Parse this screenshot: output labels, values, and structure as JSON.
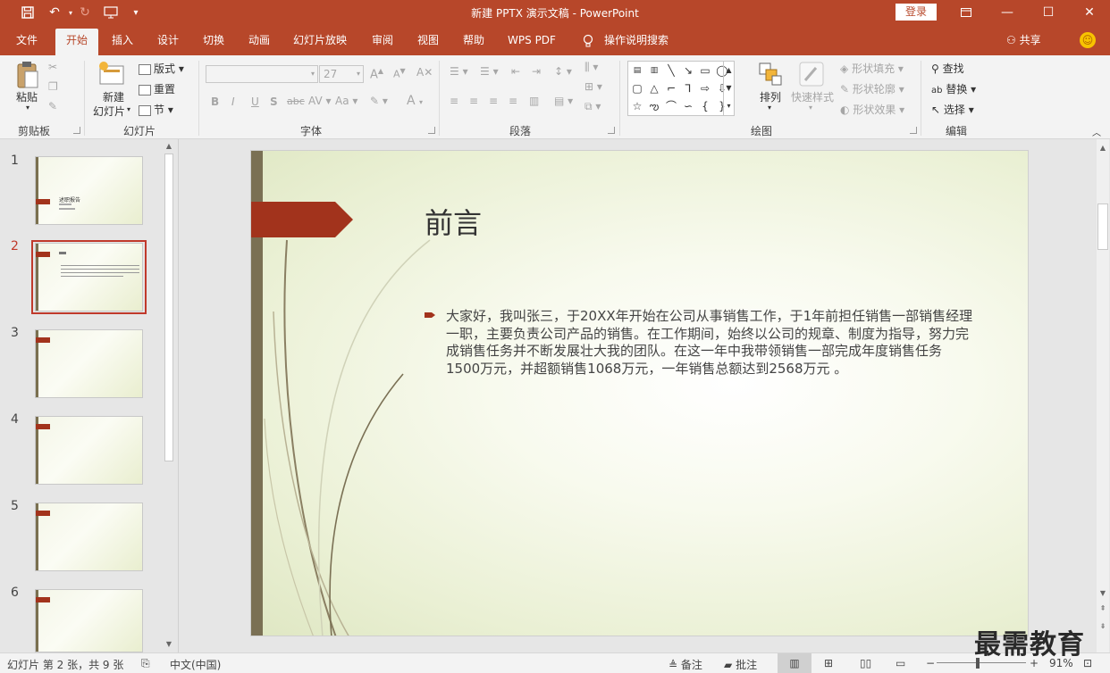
{
  "window": {
    "title": "新建 PPTX 演示文稿 - PowerPoint",
    "login_label": "登录"
  },
  "tabs": [
    {
      "label": "文件"
    },
    {
      "label": "开始"
    },
    {
      "label": "插入"
    },
    {
      "label": "设计"
    },
    {
      "label": "切换"
    },
    {
      "label": "动画"
    },
    {
      "label": "幻灯片放映"
    },
    {
      "label": "审阅"
    },
    {
      "label": "视图"
    },
    {
      "label": "帮助"
    },
    {
      "label": "WPS PDF"
    },
    {
      "label": "操作说明搜索"
    }
  ],
  "share_label": "共享",
  "ribbon": {
    "clipboard": {
      "paste": "粘贴",
      "group": "剪贴板"
    },
    "slides": {
      "new_slide_1": "新建",
      "new_slide_2": "幻灯片",
      "layout": "版式",
      "reset": "重置",
      "section": "节",
      "group": "幻灯片"
    },
    "font": {
      "size": "27",
      "group": "字体",
      "bold": "B",
      "italic": "I",
      "underline": "U",
      "strike": "abc",
      "aa": "Aa",
      "a": "A"
    },
    "paragraph": {
      "group": "段落"
    },
    "drawing": {
      "arrange": "排列",
      "quick_styles": "快速样式",
      "shape_fill": "形状填充",
      "shape_outline": "形状轮廓",
      "shape_effects": "形状效果",
      "group": "绘图"
    },
    "editing": {
      "find": "查找",
      "replace": "替换",
      "select": "选择",
      "group": "编辑"
    }
  },
  "thumbnails": {
    "numbers": [
      "1",
      "2",
      "3",
      "4",
      "5",
      "6"
    ],
    "slide1_text": "述职报告"
  },
  "slide": {
    "title": "前言",
    "body": "大家好，我叫张三，于20XX年开始在公司从事销售工作，于1年前担任销售一部销售经理一职，主要负责公司产品的销售。在工作期间，始终以公司的规章、制度为指导，努力完成销售任务并不断发展壮大我的团队。在这一年中我带领销售一部完成年度销售任务1500万元，并超额销售1068万元，一年销售总额达到2568万元 。"
  },
  "status": {
    "slide_info": "幻灯片 第 2 张，共 9 张",
    "language": "中文(中国)",
    "notes": "备注",
    "comments": "批注",
    "zoom": "91%"
  },
  "watermark": "最需教育",
  "colors": {
    "accent": "#b7472a",
    "selection": "#c0392b",
    "slide_bar": "#7a7054",
    "flag": "#a2331c"
  }
}
